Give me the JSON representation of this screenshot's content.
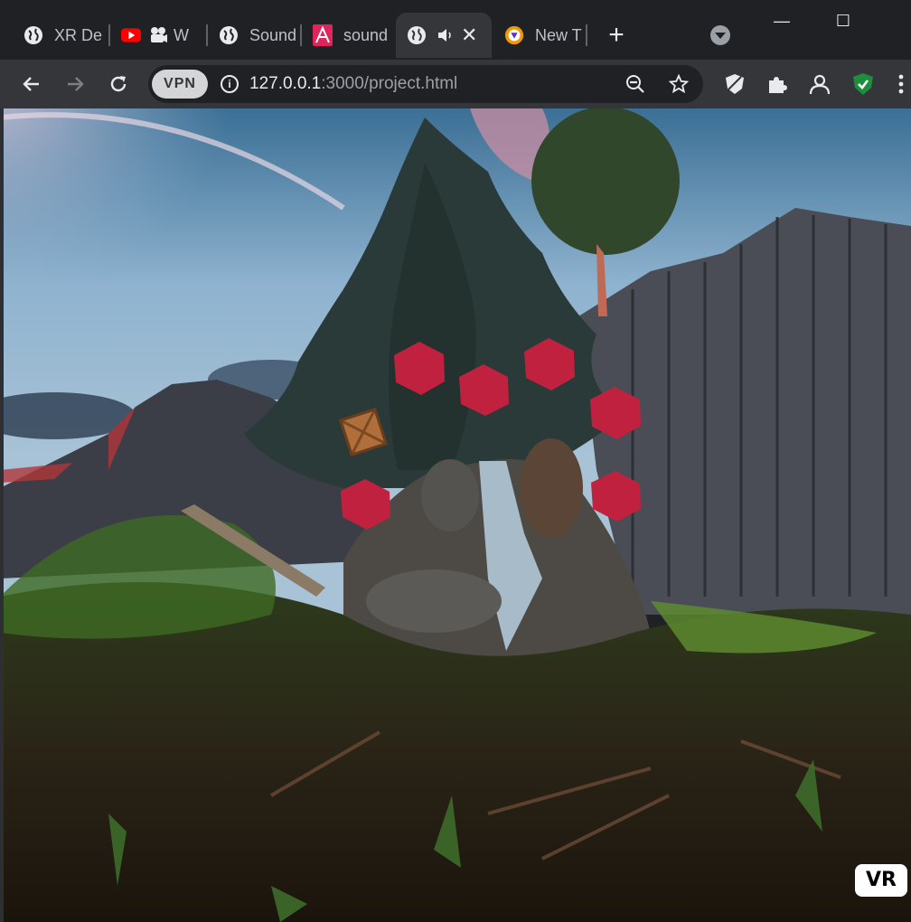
{
  "tabs": [
    {
      "title": "XR De",
      "favicon": "globe-icon"
    },
    {
      "title": "W",
      "favicon": "youtube-icon"
    },
    {
      "title": "Sound",
      "favicon": "globe-icon"
    },
    {
      "title": "sound",
      "favicon": "a-letter-icon"
    },
    {
      "title": "",
      "favicon": "globe-icon",
      "active": true,
      "audio": "speaker-icon",
      "close": "✕"
    },
    {
      "title": "New T",
      "favicon": "browser-logo-icon"
    }
  ],
  "tabstrip": {
    "new_tab": "+"
  },
  "window_controls": {
    "minimize": "—",
    "maximize": "☐"
  },
  "toolbar": {
    "vpn_label": "VPN",
    "url_host": "127.0.0.1",
    "url_rest": ":3000/project.html",
    "info_glyph": "i"
  },
  "scene": {
    "vr_button": "VR",
    "hexagon_color": "#c0213f",
    "hexagon_count": 6
  },
  "colors": {
    "tabstrip_bg": "#202124",
    "toolbar_bg": "#35363a",
    "accent_red": "#c0213f",
    "shield_green": "#1e8e3e"
  }
}
